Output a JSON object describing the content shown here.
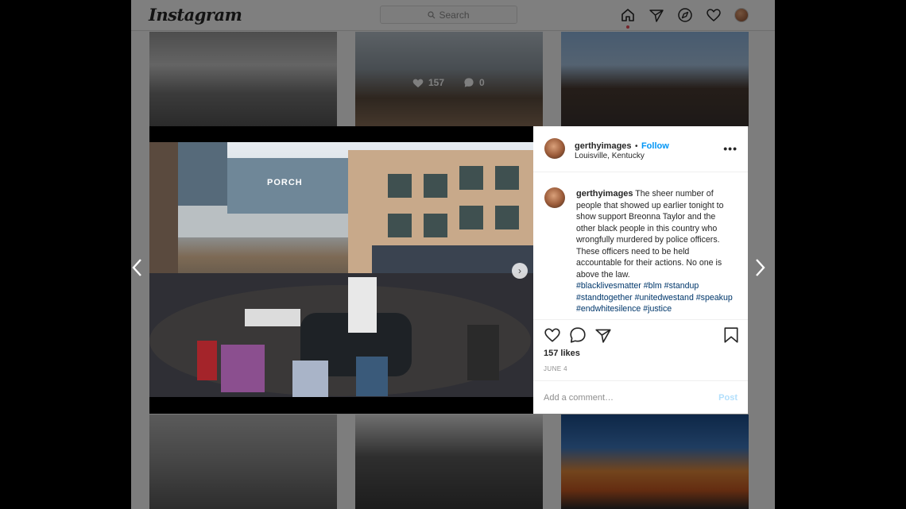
{
  "header": {
    "logo": "Instagram",
    "search_placeholder": "Search"
  },
  "grid_stats": {
    "likes": "157",
    "comments": "0"
  },
  "post": {
    "username": "gerthyimages",
    "separator": "•",
    "follow_label": "Follow",
    "location": "Louisville, Kentucky",
    "more_label": "•••",
    "caption_username": "gerthyimages",
    "caption_text": "The sheer number of people that showed up earlier tonight to show support Breonna Taylor and the other black people in this country who wrongfully murdered by police officers. These officers need to be held accountable for their actions. No one is above the law.",
    "hashtags": "#blacklivesmatter #blm #standup #standtogether #unitedwestand #speakup #endwhitesilence #justice",
    "likes": "157 likes",
    "date": "JUNE 4",
    "comment_placeholder": "Add a comment…",
    "post_label": "Post",
    "photo_sign": "PORCH"
  },
  "colors": {
    "accent": "#0095f6",
    "hashtag": "#00376b",
    "notification": "#ed4956"
  },
  "icons": [
    "home-icon",
    "direct-icon",
    "explore-icon",
    "heart-icon",
    "profile-avatar",
    "like-icon",
    "comment-icon",
    "share-icon",
    "save-icon",
    "prev-arrow-icon",
    "next-arrow-icon"
  ]
}
